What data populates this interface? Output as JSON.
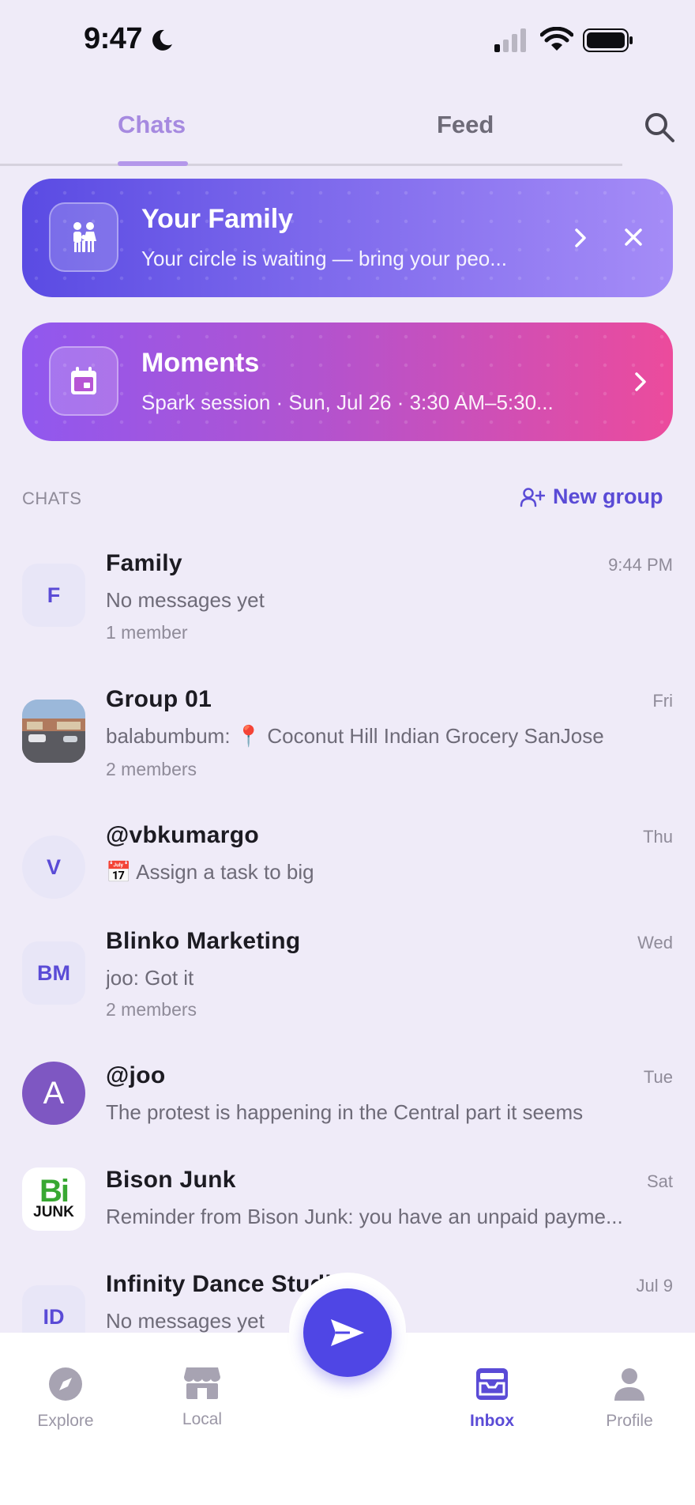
{
  "status_bar": {
    "time": "9:47"
  },
  "tabs": {
    "chats": "Chats",
    "feed": "Feed"
  },
  "banners": {
    "family": {
      "title": "Your Family",
      "subtitle": "Your circle is waiting — bring your peo..."
    },
    "moments": {
      "title": "Moments",
      "subtitle": "Spark session · Sun, Jul 26 · 3:30 AM–5:30..."
    }
  },
  "section": {
    "label": "CHATS",
    "new_group": "New group"
  },
  "chats": [
    {
      "name": "Family",
      "time": "9:44 PM",
      "preview": "No messages yet",
      "meta": "1 member",
      "avatar": "F"
    },
    {
      "name": "Group 01",
      "time": "Fri",
      "preview": "balabumbum: 📍 Coconut Hill Indian Grocery SanJose",
      "meta": "2 members"
    },
    {
      "name": "@vbkumargo",
      "time": "Thu",
      "preview": "📅 Assign a task to big",
      "avatar": "V"
    },
    {
      "name": "Blinko Marketing",
      "time": "Wed",
      "preview": "joo: Got it",
      "meta": "2 members",
      "avatar": "BM"
    },
    {
      "name": "@joo",
      "time": "Tue",
      "preview": "The protest is happening in the Central part it seems",
      "avatar": "A"
    },
    {
      "name": "Bison Junk",
      "time": "Sat",
      "preview": "Reminder from Bison Junk: you have an unpaid payme...",
      "avatar_logo": {
        "top": "Bi",
        "bottom": "JUNK"
      }
    },
    {
      "name": "Infinity Dance Studio",
      "time": "Jul 9",
      "preview": "No messages yet",
      "avatar": "ID"
    }
  ],
  "nav": {
    "explore": "Explore",
    "local": "Local",
    "inbox": "Inbox",
    "profile": "Profile"
  },
  "colors": {
    "accent": "#5a4bd6",
    "fab": "#4f46e5",
    "tab_active": "#a68ae0",
    "background": "#efebf8"
  }
}
